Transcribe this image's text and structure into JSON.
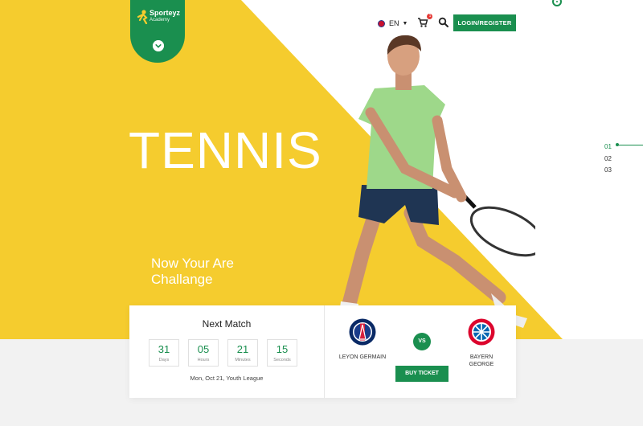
{
  "brand": {
    "name": "Sporteyz",
    "tagline": "Academy"
  },
  "header": {
    "language": "EN",
    "cart_count": "1",
    "login_label": "LOGIN/REGISTER"
  },
  "hero": {
    "title": "TENNIS",
    "subtitle": "Now Your Are Challange",
    "slides": [
      "01",
      "02",
      "03"
    ],
    "active_slide": "01"
  },
  "next_match": {
    "title": "Next Match",
    "countdown": [
      {
        "value": "31",
        "label": "Days"
      },
      {
        "value": "05",
        "label": "Hours"
      },
      {
        "value": "21",
        "label": "Minutes"
      },
      {
        "value": "15",
        "label": "Seconds"
      }
    ],
    "info": "Mon, Oct 21, Youth League",
    "home_team": "LEYON GERMAIN",
    "away_team": "BAYERN GEORGE",
    "vs_label": "VS",
    "buy_label": "BUY TICKET"
  },
  "colors": {
    "accent_green": "#1a8f4f",
    "hero_yellow": "#f5cc2e",
    "background": "#f2f2f2"
  },
  "icons": [
    "runner-logo-icon",
    "chevron-down-icon",
    "flag-uk-icon",
    "cart-icon",
    "search-icon"
  ]
}
